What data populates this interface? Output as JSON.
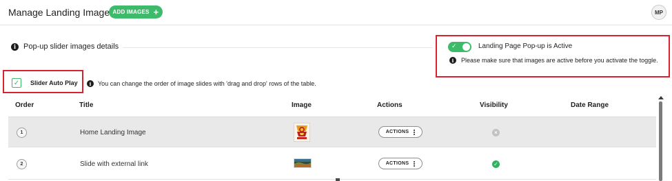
{
  "header": {
    "title": "Manage Landing Images",
    "add_button_label": "ADD IMAGES",
    "add_button_icon": "plus-icon",
    "avatar_initials": "MP"
  },
  "section": {
    "title": "Pop-up slider images details",
    "icon": "info-icon"
  },
  "popup_status": {
    "toggle_on": true,
    "toggle_label": "Landing Page Pop-up is Active",
    "note": "Please make sure that images are active before you activate the toggle."
  },
  "autoplay": {
    "checked": true,
    "label": "Slider Auto Play",
    "order_note": "You can change the order of image slides with 'drag and drop' rows of the table."
  },
  "table": {
    "columns": [
      "Order",
      "Title",
      "Image",
      "Actions",
      "Visibility",
      "Date Range"
    ],
    "rows": [
      {
        "order": "1",
        "title": "Home Landing Image",
        "actions_label": "ACTIONS",
        "visibility": "inactive",
        "date_range": ""
      },
      {
        "order": "2",
        "title": "Slide with external link",
        "actions_label": "ACTIONS",
        "visibility": "active",
        "date_range": ""
      }
    ]
  },
  "colors": {
    "accent_green": "#3dbb6a",
    "highlight_red": "#d7232f",
    "inactive_gray": "#c2c2c2"
  }
}
